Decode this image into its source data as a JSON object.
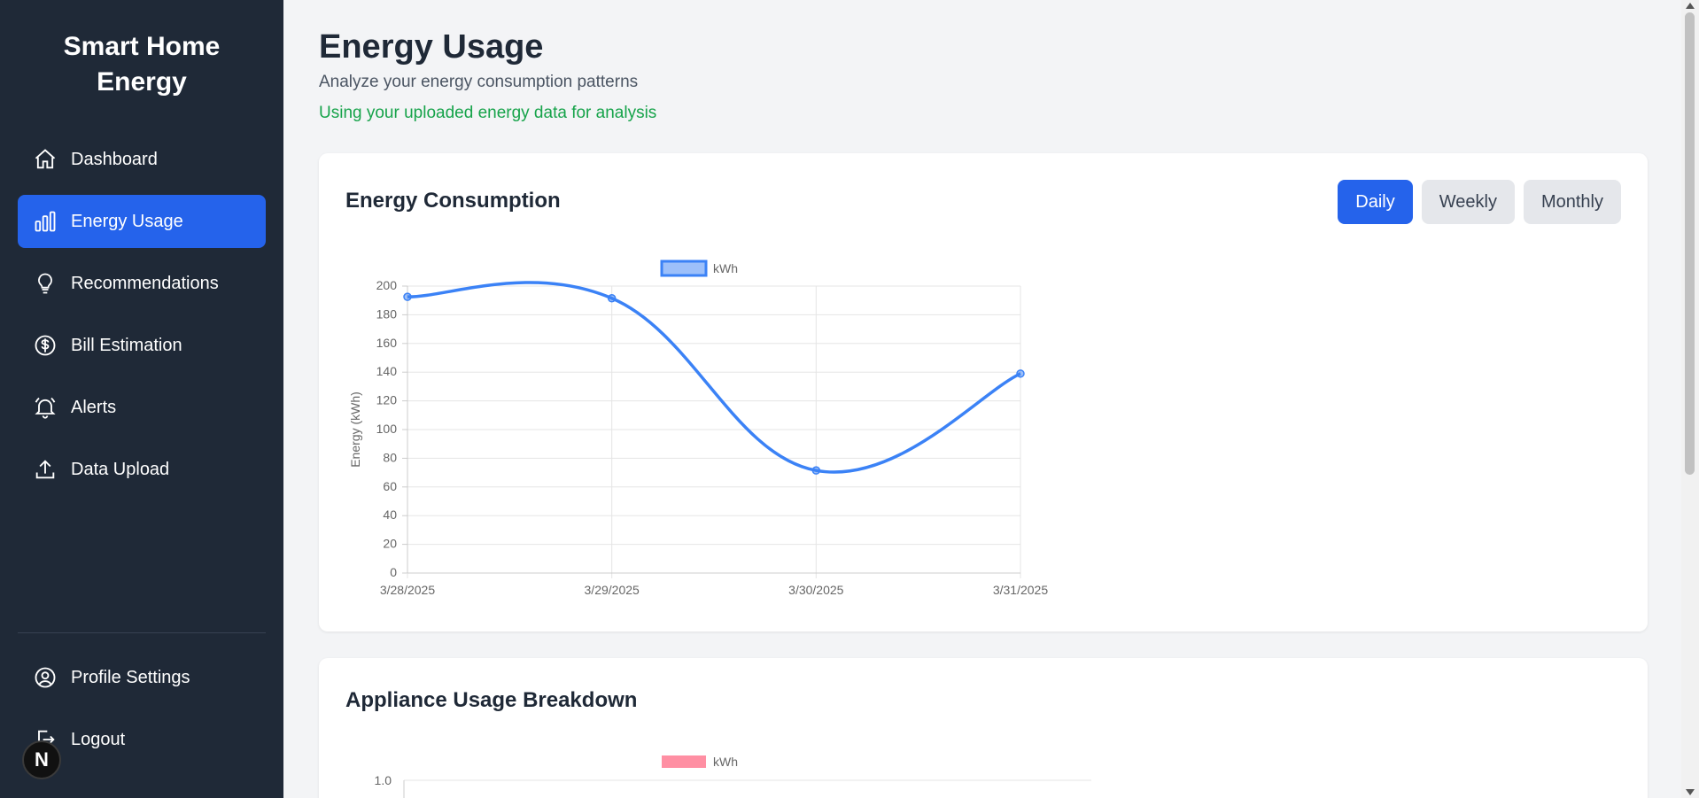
{
  "sidebar": {
    "brand_line1": "Smart Home",
    "brand_line2": "Energy",
    "items": [
      {
        "label": "Dashboard",
        "icon": "home-icon",
        "active": false
      },
      {
        "label": "Energy Usage",
        "icon": "bar-chart-icon",
        "active": true
      },
      {
        "label": "Recommendations",
        "icon": "lightbulb-icon",
        "active": false
      },
      {
        "label": "Bill Estimation",
        "icon": "dollar-circle-icon",
        "active": false
      },
      {
        "label": "Alerts",
        "icon": "bell-icon",
        "active": false
      },
      {
        "label": "Data Upload",
        "icon": "upload-icon",
        "active": false
      }
    ],
    "bottom_items": [
      {
        "label": "Profile Settings",
        "icon": "user-circle-icon"
      },
      {
        "label": "Logout",
        "icon": "logout-icon"
      }
    ],
    "badge_letter": "N"
  },
  "main": {
    "title": "Energy Usage",
    "subtitle": "Analyze your energy consumption patterns",
    "note": "Using your uploaded energy data for analysis",
    "consumption_card": {
      "title": "Energy Consumption",
      "periods": [
        "Daily",
        "Weekly",
        "Monthly"
      ],
      "active_period": "Daily"
    },
    "appliance_card": {
      "title": "Appliance Usage Breakdown"
    }
  },
  "colors": {
    "sidebar_bg": "#1f2937",
    "accent": "#2563eb",
    "line": "#3b82f6",
    "note_green": "#16a34a",
    "appliance_legend": "#ff8fa3"
  },
  "chart_data": [
    {
      "type": "line",
      "legend": "kWh",
      "ylabel": "Energy (kWh)",
      "xlabel": "",
      "categories": [
        "3/28/2025",
        "3/29/2025",
        "3/30/2025",
        "3/31/2025"
      ],
      "values": [
        192.5,
        191.5,
        71.5,
        139
      ],
      "ylim": [
        0,
        200
      ],
      "yticks": [
        0,
        20,
        40,
        60,
        80,
        100,
        120,
        140,
        160,
        180,
        200
      ],
      "grid": true,
      "legend_position": "top"
    },
    {
      "type": "bar",
      "legend": "kWh",
      "ylim_top_tick": "1.0",
      "values": []
    }
  ]
}
